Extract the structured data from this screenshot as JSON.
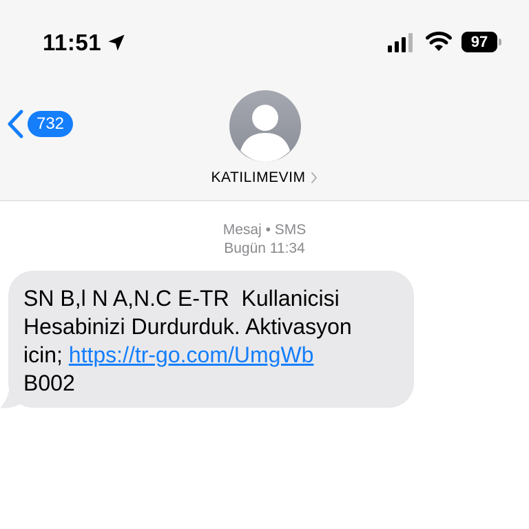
{
  "status_bar": {
    "time": "11:51",
    "battery": "97",
    "icons": [
      "location-arrow-icon",
      "cellular-signal-icon",
      "wifi-icon",
      "battery-icon"
    ]
  },
  "nav": {
    "back_badge": "732",
    "contact_name": "KATILIMEVIM"
  },
  "conversation": {
    "service_label": "Mesaj • SMS",
    "timestamp": "Bugün 11:34",
    "message": {
      "line1": "SN B,l N A,N.C E-TR  Kullanicisi",
      "line2": "Hesabinizi Durdurduk. Aktivasyon",
      "line3_prefix": "icin; ",
      "link": "https://tr-go.com/UmgWb",
      "line4": "B002"
    }
  },
  "colors": {
    "accent": "#147efb",
    "bubble": "#e9e9eb",
    "header_bg": "#f6f6f6",
    "meta_text": "#8a8a8e"
  }
}
